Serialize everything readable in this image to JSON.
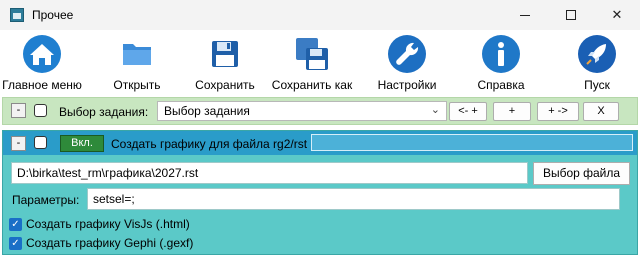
{
  "window": {
    "title": "Прочее",
    "minimize": "–",
    "maximize": "□",
    "close": "✕"
  },
  "toolbar": [
    {
      "label": "Главное меню",
      "icon": "home-icon"
    },
    {
      "label": "Открыть",
      "icon": "folder-icon"
    },
    {
      "label": "Сохранить",
      "icon": "floppy-disk-icon"
    },
    {
      "label": "Сохранить как",
      "icon": "floppy-disks-icon"
    },
    {
      "label": "Настройки",
      "icon": "wrench-icon"
    },
    {
      "label": "Справка",
      "icon": "info-icon"
    },
    {
      "label": "Пуск",
      "icon": "rocket-icon"
    }
  ],
  "task_row": {
    "collapse": "-",
    "label": "Выбор задания:",
    "select_value": "Выбор задания",
    "buttons": [
      "<- +",
      "+",
      "+ ->",
      "X"
    ]
  },
  "task": {
    "collapse": "-",
    "enabled_label": "Вкл.",
    "title": "Создать графику для файла rg2/rst",
    "progress": 0,
    "file_path": "D:\\birka\\test_rm\\графика\\2027.rst",
    "browse_label": "Выбор файла",
    "params_label": "Параметры:",
    "params_value": "setsel=;",
    "options": [
      {
        "label": "Создать графику VisJs (.html)",
        "checked": true
      },
      {
        "label": "Создать графику Gephi (.gexf)",
        "checked": true
      }
    ]
  },
  "colors": {
    "task_row_bg": "#c8e6c0",
    "panel_bg": "#5bc9c8",
    "panel_header": "#2a9cc9",
    "enabled_badge": "#2e8a3a",
    "checkbox": "#1a6fc7"
  }
}
